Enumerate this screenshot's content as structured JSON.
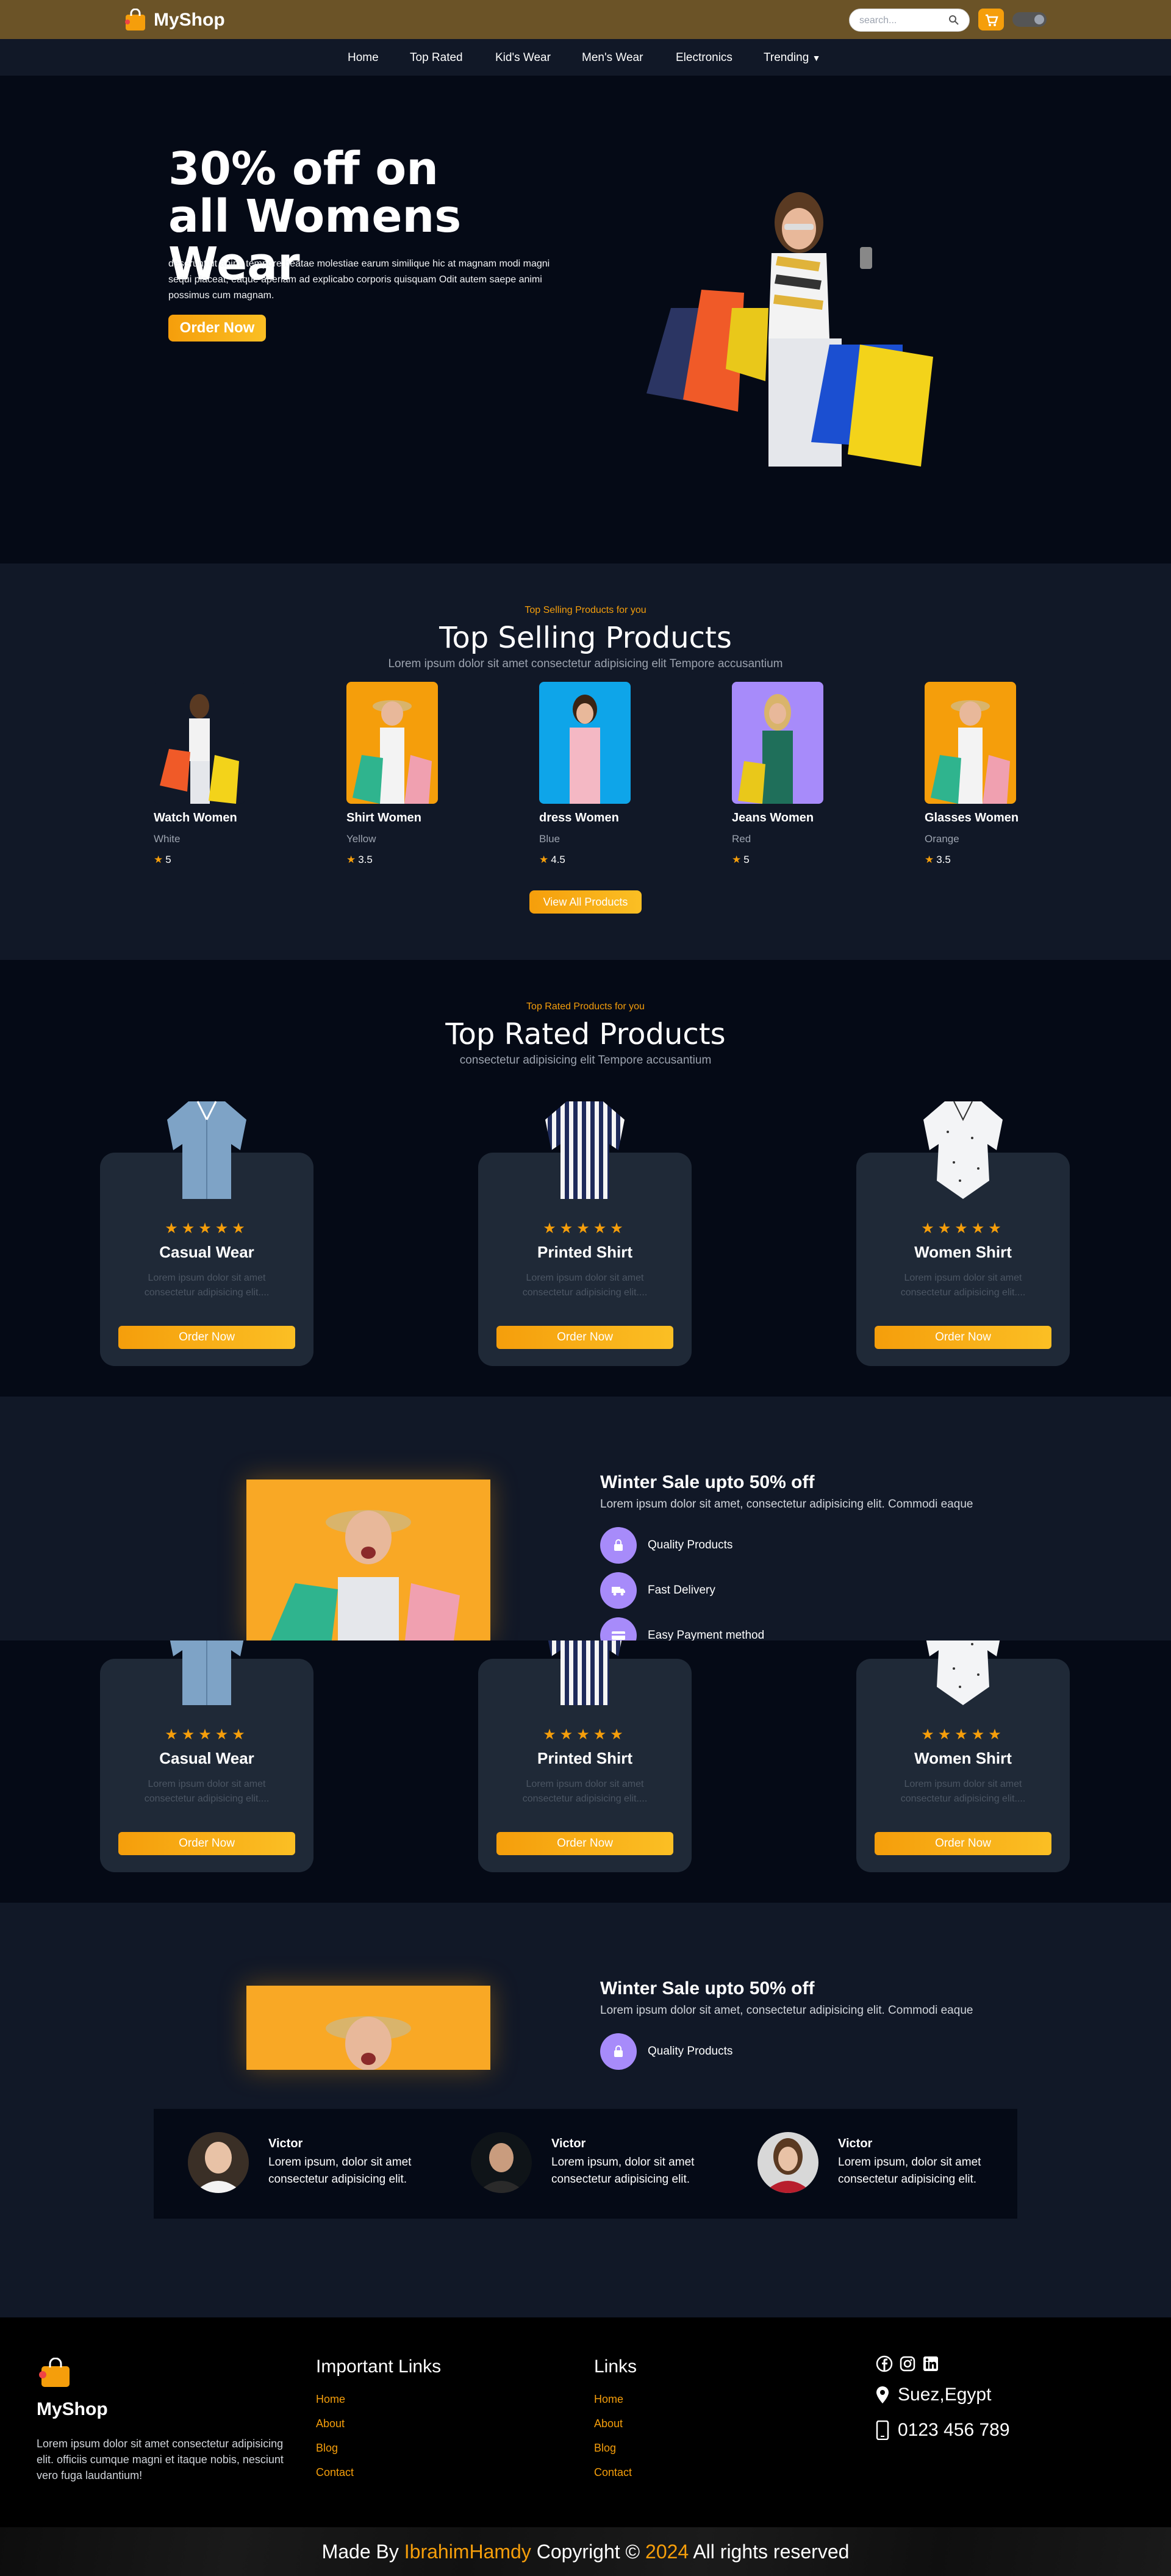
{
  "header": {
    "brand": "MyShop",
    "search_placeholder": "search...",
    "accent": "#f59e0b",
    "bar_color": "#6b5327"
  },
  "nav": {
    "items": [
      "Home",
      "Top Rated",
      "Kid's Wear",
      "Men's Wear",
      "Electronics",
      "Trending"
    ]
  },
  "hero": {
    "title": "30% off on all Womens Wear",
    "description": "deserunt ut animi tempore beatae molestiae earum similique hic at magnam modi magni sequi placeat, eaque aperiam ad explicabo corporis quisquam Odit autem saepe animi possimus cum magnam.",
    "button": "Order Now"
  },
  "top_selling": {
    "subtitle": "Top Selling Products for you",
    "title": "Top Selling Products",
    "description": "Lorem ipsum dolor sit amet consectetur adipisicing elit Tempore accusantium",
    "products": [
      {
        "name": "Watch Women",
        "color": "White",
        "rating": "5"
      },
      {
        "name": "Shirt Women",
        "color": "Yellow",
        "rating": "3.5"
      },
      {
        "name": "dress Women",
        "color": "Blue",
        "rating": "4.5"
      },
      {
        "name": "Jeans Women",
        "color": "Red",
        "rating": "5"
      },
      {
        "name": "Glasses Women",
        "color": "Orange",
        "rating": "3.5"
      }
    ],
    "button": "View All Products"
  },
  "top_rated": {
    "subtitle": "Top Rated Products for you",
    "title": "Top Rated Products",
    "description": "consectetur adipisicing elit Tempore accusantium",
    "cards": [
      {
        "title": "Casual Wear",
        "desc": "Lorem ipsum dolor sit amet consectetur adipisicing elit....",
        "button": "Order Now",
        "stars": "★★★★★"
      },
      {
        "title": "Printed Shirt",
        "desc": "Lorem ipsum dolor sit amet consectetur adipisicing elit....",
        "button": "Order Now",
        "stars": "★★★★★"
      },
      {
        "title": "Women Shirt",
        "desc": "Lorem ipsum dolor sit amet consectetur adipisicing elit....",
        "button": "Order Now",
        "stars": "★★★★★"
      }
    ]
  },
  "winter": {
    "title": "Winter Sale upto 50% off",
    "description": "Lorem ipsum dolor sit amet, consectetur adipisicing elit. Commodi eaque",
    "features": [
      "Quality Products",
      "Fast Delivery",
      "Easy Payment method"
    ]
  },
  "testimonials": [
    {
      "name": "Victor",
      "text": "Lorem ipsum, dolor sit amet consectetur adipisicing elit."
    },
    {
      "name": "Victor",
      "text": "Lorem ipsum, dolor sit amet consectetur adipisicing elit."
    },
    {
      "name": "Victor",
      "text": "Lorem ipsum, dolor sit amet consectetur adipisicing elit."
    }
  ],
  "footer": {
    "brand": "MyShop",
    "description": "Lorem ipsum dolor sit amet consectetur adipisicing elit. officiis cumque magni et itaque nobis, nesciunt vero fuga laudantium!",
    "important_links_title": "Important Links",
    "important_links": [
      "Home",
      "About",
      "Blog",
      "Contact"
    ],
    "links_title": "Links",
    "links": [
      "Home",
      "About",
      "Blog",
      "Contact"
    ],
    "location": "Suez,Egypt",
    "phone": "0123 456 789",
    "social_icons": [
      "facebook-icon",
      "instagram-icon",
      "linkedin-icon"
    ]
  },
  "copyright": {
    "prefix": "Made By",
    "author": "IbrahimHamdy",
    "middle": "Copyright ©",
    "year": "2024",
    "suffix": "All rights reserved"
  }
}
